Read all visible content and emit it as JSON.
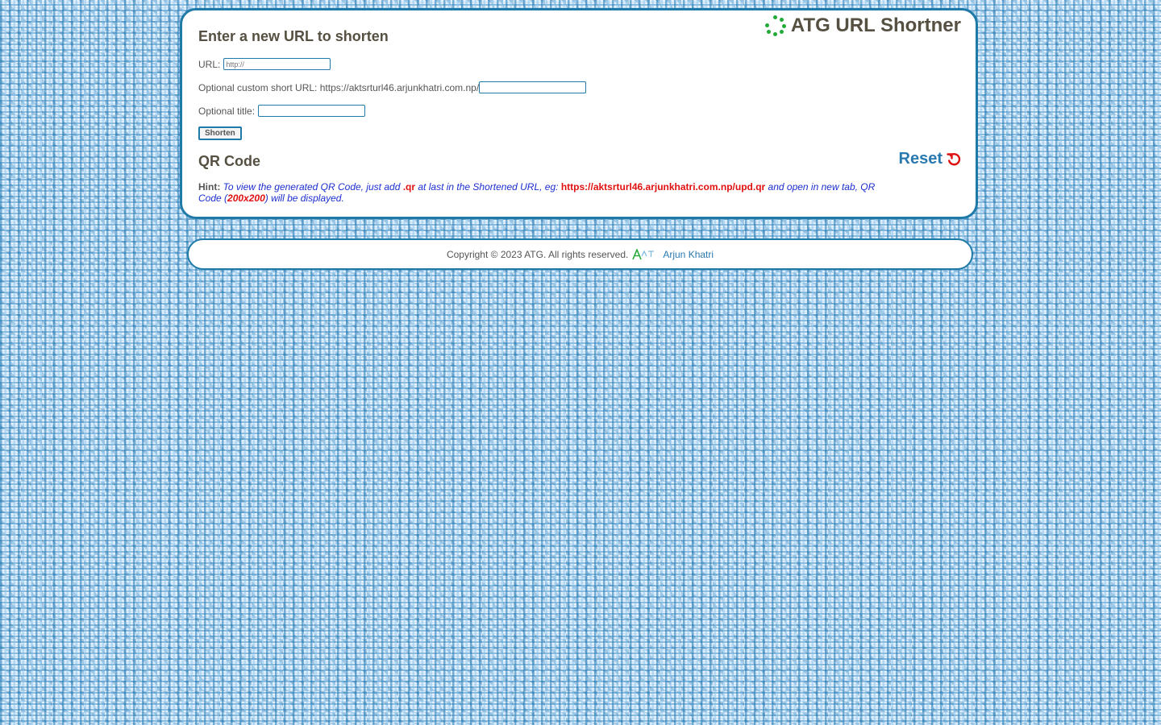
{
  "header": {
    "brand_title": "ATG URL Shortner"
  },
  "form": {
    "title": "Enter a new URL to shorten",
    "url_label": "URL:",
    "url_placeholder": "http://",
    "custom_label": "Optional custom short URL: https://aktsrturl46.arjunkhatri.com.np/",
    "custom_value": "",
    "title_label": "Optional title:",
    "title_value": "",
    "submit_label": "Shorten"
  },
  "qr": {
    "title": "QR Code",
    "reset_label": "Reset",
    "hint_label": "Hint:",
    "hint_part1": "To view the generated QR Code, just add ",
    "hint_ext": ".qr",
    "hint_part2": " at last in the Shortened URL, eg: ",
    "hint_example": "https://aktsrturl46.arjunkhatri.com.np/upd.qr",
    "hint_part3": " and open in new tab, QR Code (",
    "hint_size": "200x200",
    "hint_part4": ") will be displayed."
  },
  "footer": {
    "copyright": "Copyright © 2023 ATG. All rights reserved.",
    "author": "Arjun Khatri"
  },
  "colors": {
    "accent": "#1f7aa8",
    "link": "#2a7ab0",
    "hint_text": "#1c2fcf",
    "highlight": "#e01010",
    "spinner": "#22aa3a"
  }
}
